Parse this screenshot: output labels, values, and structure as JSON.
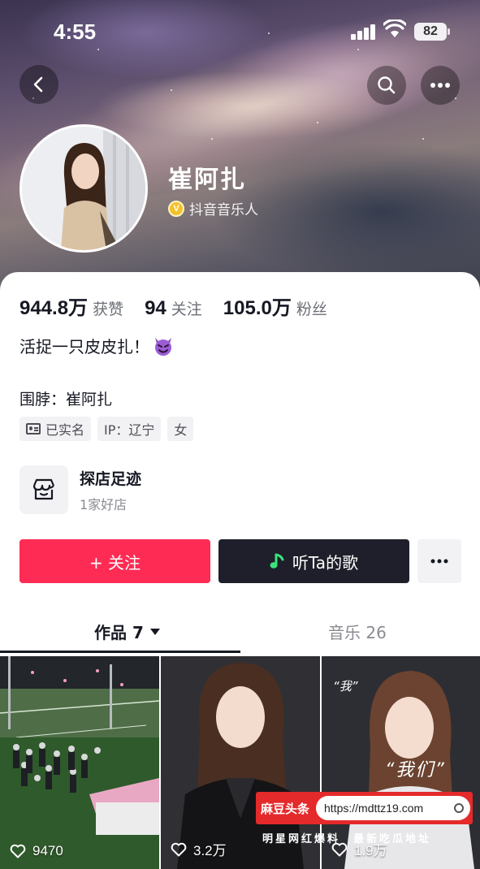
{
  "status_bar": {
    "time": "4:55",
    "battery": "82"
  },
  "profile": {
    "name": "崔阿扎",
    "verified_label": "抖音音乐人",
    "verified_badge": "V"
  },
  "stats": [
    {
      "value": "944.8万",
      "label": "获赞"
    },
    {
      "value": "94",
      "label": "关注"
    },
    {
      "value": "105.0万",
      "label": "粉丝"
    }
  ],
  "bio": {
    "text": "活捉一只皮皮扎！"
  },
  "scarf": {
    "text": "围脖：崔阿扎"
  },
  "tags": [
    {
      "label": "已实名",
      "icon": "id-card-icon"
    },
    {
      "label": "IP：辽宁"
    },
    {
      "label": "女"
    }
  ],
  "shop": {
    "title": "探店足迹",
    "subtitle": "1家好店",
    "icon": "shop-icon"
  },
  "actions": {
    "follow": "+ 关注",
    "listen": "听Ta的歌",
    "more_icon": "more-dots-icon"
  },
  "tabs": [
    {
      "label": "作品 7",
      "active": true
    },
    {
      "label": "音乐 26",
      "active": false
    }
  ],
  "videos": [
    {
      "likes": "9470"
    },
    {
      "likes": "3.2万"
    },
    {
      "likes": "1.9万",
      "caption_small": "“我”",
      "caption_big": "“我们”"
    }
  ],
  "overlay_ad": {
    "brand": "麻豆头条",
    "url": "https://mdttz19.com",
    "tagline": "明星网红爆料　最新吃瓜地址"
  },
  "colors": {
    "accent": "#fe2c55",
    "dark_button": "#1f1f2b",
    "ad_red": "#e42a2a"
  }
}
